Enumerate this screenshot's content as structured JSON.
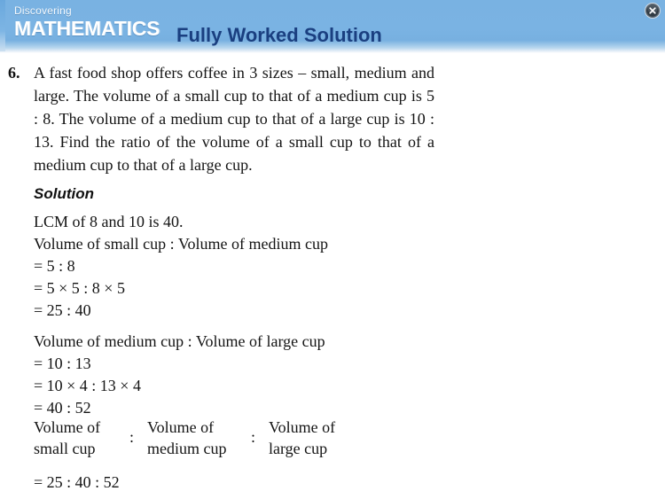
{
  "header": {
    "logo_line1": "Discovering",
    "logo_line2": "MATHEMATICS",
    "title": "Fully Worked Solution",
    "close_label": "Close",
    "banner_color": "#7ab3e3",
    "title_color": "#1a3f80",
    "logo_color": "#ffffff"
  },
  "question": {
    "number": "6.",
    "text": "A fast food shop offers coffee in 3 sizes – small, medium and large. The volume of a small cup to that of a medium cup is 5 : 8. The volume of a medium cup to that of a large cup is 10 : 13. Find the ratio of the volume of a small cup to that of a medium cup to that of a large cup."
  },
  "solution": {
    "heading": "Solution",
    "lines": [
      "LCM of 8 and 10 is 40.",
      "Volume of small cup : Volume of medium cup",
      "= 5 : 8",
      "= 5 × 5 : 8 × 5",
      "= 25 : 40",
      "Volume of medium cup : Volume of large cup",
      "= 10 : 13",
      "= 10 × 4 : 13 × 4",
      "= 40 : 52"
    ],
    "ratio_columns": [
      {
        "line1": "Volume of",
        "line2": "small cup"
      },
      {
        "line1": "Volume of",
        "line2": "medium cup"
      },
      {
        "line1": "Volume of",
        "line2": "large cup"
      }
    ],
    "ratio_separator": ":",
    "final_answer": "= 25 : 40 : 52"
  }
}
